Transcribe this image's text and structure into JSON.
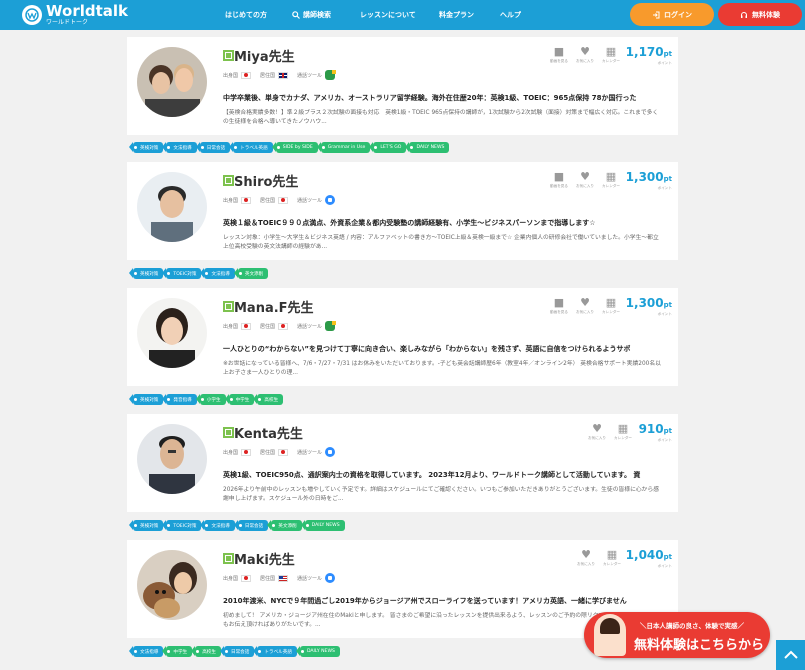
{
  "header": {
    "logo_name": "Worldtalk",
    "logo_sub": "ワールドトーク",
    "nav": [
      "はじめての方",
      "講師検索",
      "レッスンについて",
      "料金プラン",
      "ヘルプ"
    ],
    "login_label": "ログイン",
    "trial_label": "無料体験",
    "brand_color": "#1c9fd6"
  },
  "labels": {
    "country": "出身国",
    "residence": "居住国",
    "tool": "通話ツール",
    "video": "動画を見る",
    "favorite": "お気に入り",
    "calendar": "カレンダー",
    "points": "ポイント"
  },
  "teachers": [
    {
      "name": "Miya先生",
      "country_flag": "jp",
      "residence_flag": "uk",
      "tool_icon": "google-meet",
      "price": "1,170",
      "unit": "pt",
      "has_video": true,
      "headline": "中学卒業後、単身でカナダ、アメリカ、オーストラリア留学経験。海外在住歴20年：英検1級、TOEIC：965点保持 78か国行った",
      "desc": "【英検合格実績多数！】準２級プラス２次試験の面接も対応　英検1級・TOEIC 965点保持の講師が，1次試験から2次試験（面接）対策まで幅広く対応。これまで多くの生徒様を合格へ導いてきたノウハウ...",
      "tags": [
        {
          "label": "英検対策",
          "color": "b"
        },
        {
          "label": "文法指導",
          "color": "b"
        },
        {
          "label": "日常会話",
          "color": "b"
        },
        {
          "label": "トラベル英語",
          "color": "b"
        },
        {
          "label": "SIDE by SIDE",
          "color": "g"
        },
        {
          "label": "Grammar in Use",
          "color": "g"
        },
        {
          "label": "LET'S GO",
          "color": "g"
        },
        {
          "label": "DAILY NEWS",
          "color": "g"
        }
      ]
    },
    {
      "name": "Shiro先生",
      "country_flag": "jp",
      "residence_flag": "jp",
      "tool_icon": "zoom",
      "price": "1,300",
      "unit": "pt",
      "has_video": true,
      "headline": "英検１級＆TOEIC９９０点満点、外資系企業＆都内受験塾の講師経験有、小学生～ビジネスパーソンまで指導します☆",
      "desc": "レッスン対象：小学生～大学生＆ビジネス英語 / 内容：アルファベットの書き方～TOEIC上級＆英検一級まで☆ 企業内個人の研修会社で働いていました。小学生～都立上位高校受験の英文法講師の経験があ...",
      "tags": [
        {
          "label": "英検対策",
          "color": "b"
        },
        {
          "label": "TOEIC対策",
          "color": "b"
        },
        {
          "label": "文法指導",
          "color": "b"
        },
        {
          "label": "英文添削",
          "color": "g"
        }
      ]
    },
    {
      "name": "Mana.F先生",
      "country_flag": "jp",
      "residence_flag": "jp",
      "tool_icon": "google-meet",
      "price": "1,300",
      "unit": "pt",
      "has_video": true,
      "headline": "一人ひとりの“わからない”を見つけて丁寧に向き合い、楽しみながら「わからない」を残さず、英語に自信をつけられるようサポ",
      "desc": "※お世話になっている皆様へ、7/6・7/27・7/31 はお休みをいただいております。-子ども英会話講師歴6年（教室4年／オンライン2年） 英検合格サポート実績200名以上お子さま一人ひとりの理...",
      "tags": [
        {
          "label": "英検対策",
          "color": "b"
        },
        {
          "label": "発音指導",
          "color": "b"
        },
        {
          "label": "小学生",
          "color": "g"
        },
        {
          "label": "中学生",
          "color": "g"
        },
        {
          "label": "高校生",
          "color": "g"
        }
      ]
    },
    {
      "name": "Kenta先生",
      "country_flag": "jp",
      "residence_flag": "jp",
      "tool_icon": "zoom",
      "price": "910",
      "unit": "pt",
      "has_video": false,
      "headline": "英検1級、TOEIC950点、通訳案内士の資格を取得しています。 2023年12月より、ワールドトーク講師として活動しています。 資",
      "desc": "2026年より午前中のレッスンも増やしていく予定です。詳細はスケジュールにてご確認ください。いつもご参加いただきありがとうございます。生徒の皆様に心から感謝申し上げます。スケジュール外の日時をご...",
      "tags": [
        {
          "label": "英検対策",
          "color": "b"
        },
        {
          "label": "TOEIC対策",
          "color": "b"
        },
        {
          "label": "文法指導",
          "color": "b"
        },
        {
          "label": "日常会話",
          "color": "b"
        },
        {
          "label": "英文添削",
          "color": "g"
        },
        {
          "label": "DAILY NEWS",
          "color": "g"
        }
      ]
    },
    {
      "name": "Maki先生",
      "country_flag": "jp",
      "residence_flag": "us",
      "tool_icon": "zoom",
      "price": "1,040",
      "unit": "pt",
      "has_video": false,
      "headline": "2010年渡米、NYCで９年間過ごし2019年からジョージア州でスローライフを送っています！アメリカ英語、一緒に学びません",
      "desc": "初めまして！ アメリカ・ジョージア州在住のMakiと申します。 皆さまのご希望に沿ったレッスンを提供出来るよう、レッスンのご予約の際リクエスト等はどんなことでもお伝え頂ければありがたいです。...",
      "tags": [
        {
          "label": "文法指導",
          "color": "b"
        },
        {
          "label": "中学生",
          "color": "g"
        },
        {
          "label": "高校生",
          "color": "g"
        },
        {
          "label": "日常会話",
          "color": "b"
        },
        {
          "label": "トラベル英語",
          "color": "b"
        },
        {
          "label": "DAILY NEWS",
          "color": "g"
        }
      ]
    }
  ],
  "banner": {
    "sub": "＼日本人講師の良さ、体験で実感／",
    "title": "無料体験はこちらから"
  }
}
